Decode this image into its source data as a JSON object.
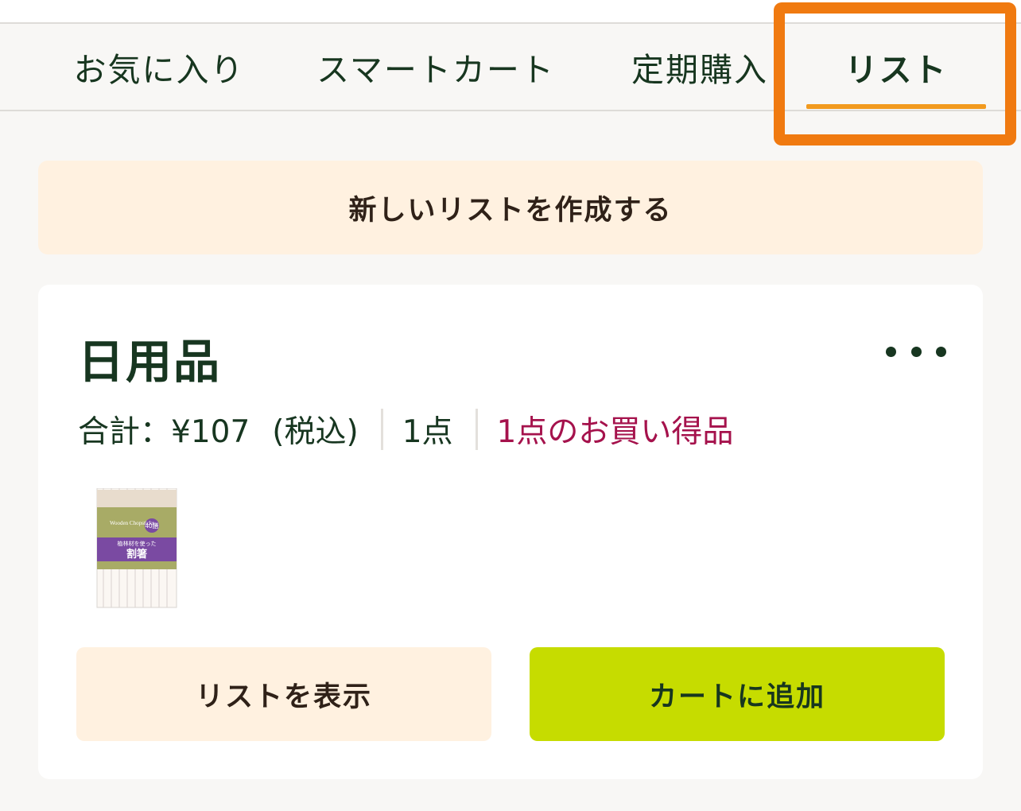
{
  "tabs": [
    {
      "label": "お気に入り",
      "active": false
    },
    {
      "label": "スマートカート",
      "active": false
    },
    {
      "label": "定期購入",
      "active": false
    },
    {
      "label": "リスト",
      "active": true
    }
  ],
  "colors": {
    "active_underline": "#f29a1e",
    "highlight_frame": "#f07a10",
    "primary_text": "#173620",
    "deal_text": "#a5124c",
    "cart_button": "#c6dc00",
    "soft_button": "#fff1e0"
  },
  "create_list": {
    "label": "新しいリストを作成する"
  },
  "list_card": {
    "title": "日用品",
    "menu_icon": "more-horizontal-icon",
    "total_label": "合計：¥107",
    "tax_label": "(税込)",
    "item_count": "1点",
    "deal_text": "1点のお買い得品",
    "product": {
      "name": "割箸",
      "subtitle": "植林材を使った",
      "english": "Wooden Chopsticks",
      "count_badge": "40膳"
    },
    "view_button": "リストを表示",
    "add_to_cart_button": "カートに追加"
  }
}
